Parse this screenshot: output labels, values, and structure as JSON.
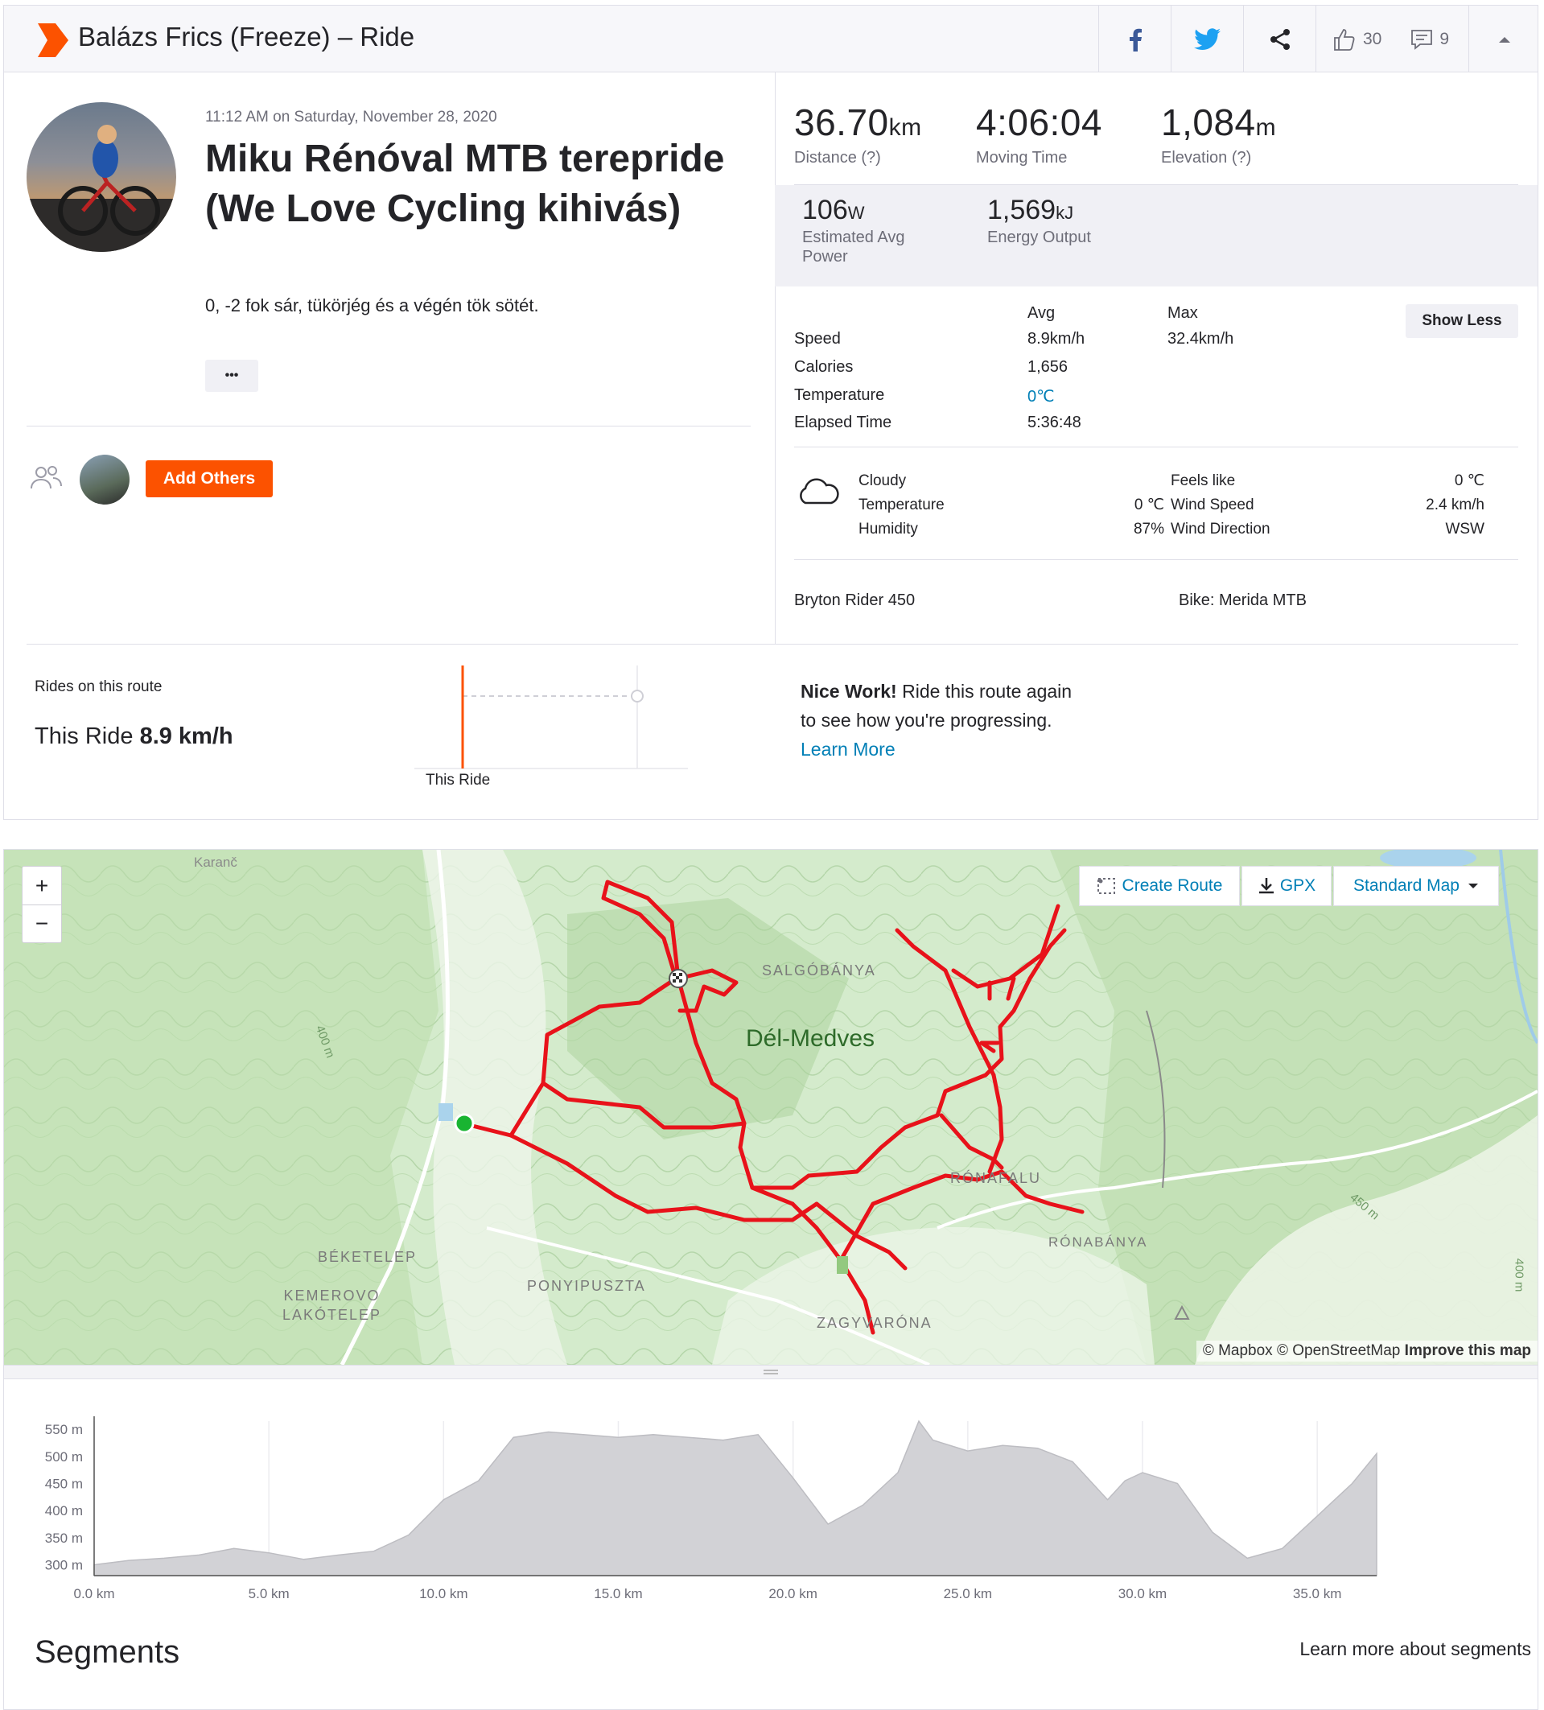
{
  "header": {
    "title": "Balázs Frics (Freeze) – Ride",
    "kudos_count": "30",
    "comments_count": "9"
  },
  "activity": {
    "datetime": "11:12 AM on Saturday, November 28, 2020",
    "title": "Miku Rénóval MTB terepride (We Love Cycling kihivás)",
    "description": "0, -2 fok sár, tükörjég és a végén tök sötét.",
    "more_label": "•••",
    "add_others_label": "Add Others"
  },
  "stats": {
    "distance": {
      "value": "36.70",
      "unit": "km",
      "label": "Distance (?)"
    },
    "moving_time": {
      "value": "4:06:04",
      "label": "Moving Time"
    },
    "elevation": {
      "value": "1,084",
      "unit": "m",
      "label": "Elevation (?)"
    },
    "power": {
      "value": "106",
      "unit": "W",
      "label_line1": "Estimated Avg",
      "label_line2": "Power"
    },
    "energy": {
      "value": "1,569",
      "unit": "kJ",
      "label": "Energy Output"
    }
  },
  "details": {
    "avg_header": "Avg",
    "max_header": "Max",
    "show_less_label": "Show Less",
    "rows": [
      {
        "label": "Speed",
        "avg": "8.9km/h",
        "max": "32.4km/h"
      },
      {
        "label": "Calories",
        "avg": "1,656",
        "max": ""
      },
      {
        "label": "Temperature",
        "avg": "0℃",
        "max": ""
      },
      {
        "label": "Elapsed Time",
        "avg": "5:36:48",
        "max": ""
      }
    ]
  },
  "weather": {
    "condition": "Cloudy",
    "temperature_label": "Temperature",
    "temperature": "0 ℃",
    "humidity_label": "Humidity",
    "humidity": "87%",
    "feels_like_label": "Feels like",
    "feels_like": "0 ℃",
    "wind_speed_label": "Wind Speed",
    "wind_speed": "2.4 km/h",
    "wind_direction_label": "Wind Direction",
    "wind_direction": "WSW"
  },
  "gear": {
    "device": "Bryton Rider 450",
    "bike": "Bike: Merida MTB"
  },
  "route_compare": {
    "heading": "Rides on this route",
    "this_ride_label": "This Ride",
    "this_ride_value": "8.9 km/h",
    "chart_label": "This Ride",
    "nice_work": "Nice Work!",
    "message_line1": "Ride this route again",
    "message_line2": "to see how you're progressing.",
    "learn_more": "Learn More"
  },
  "map": {
    "zoom_in": "+",
    "zoom_out": "−",
    "create_route": "Create Route",
    "gpx": "GPX",
    "map_style": "Standard Map",
    "attribution_mapbox": "© Mapbox",
    "attribution_osm": "© OpenStreetMap",
    "improve": "Improve this map",
    "labels": {
      "karanc": "Karanč",
      "salgobanya": "SALGÓBÁNYA",
      "del_medves": "Dél-Medves",
      "ronafalu": "RÓNAFALU",
      "ronabanya": "RÓNABÁNYA",
      "beketelep": "BÉKETELEP",
      "kemerovo1": "KEMEROVO",
      "kemerovo2": "LAKÓTELEP",
      "ponyipuszta": "PONYIPUSZTA",
      "zagyvarona": "ZAGYVARÓNA",
      "contour_400a": "400 m",
      "contour_450": "450 m",
      "contour_400b": "400 m"
    }
  },
  "chart_data": {
    "type": "area",
    "x_unit": "km",
    "y_unit": "m",
    "xlim": [
      0,
      36.7
    ],
    "ylim": [
      280,
      565
    ],
    "x_ticks": [
      "0.0 km",
      "5.0 km",
      "10.0 km",
      "15.0 km",
      "20.0 km",
      "25.0 km",
      "30.0 km",
      "35.0 km"
    ],
    "y_ticks": [
      "550 m",
      "500 m",
      "450 m",
      "400 m",
      "350 m",
      "300 m"
    ],
    "x": [
      0,
      1,
      2,
      3,
      4,
      5,
      6,
      7,
      8,
      9,
      10,
      11,
      12,
      13,
      14,
      15,
      16,
      17,
      18,
      19,
      20,
      21,
      22,
      23,
      23.6,
      24,
      25,
      26,
      27,
      28,
      29,
      29.5,
      30,
      31,
      32,
      33,
      34,
      35,
      36,
      36.7
    ],
    "y": [
      300,
      308,
      312,
      318,
      330,
      322,
      310,
      318,
      325,
      355,
      420,
      455,
      535,
      545,
      540,
      535,
      540,
      535,
      530,
      540,
      460,
      375,
      410,
      470,
      565,
      530,
      510,
      520,
      515,
      490,
      420,
      455,
      470,
      450,
      360,
      312,
      330,
      390,
      450,
      505
    ]
  },
  "segments": {
    "title": "Segments",
    "learn_more": "Learn more about segments"
  }
}
